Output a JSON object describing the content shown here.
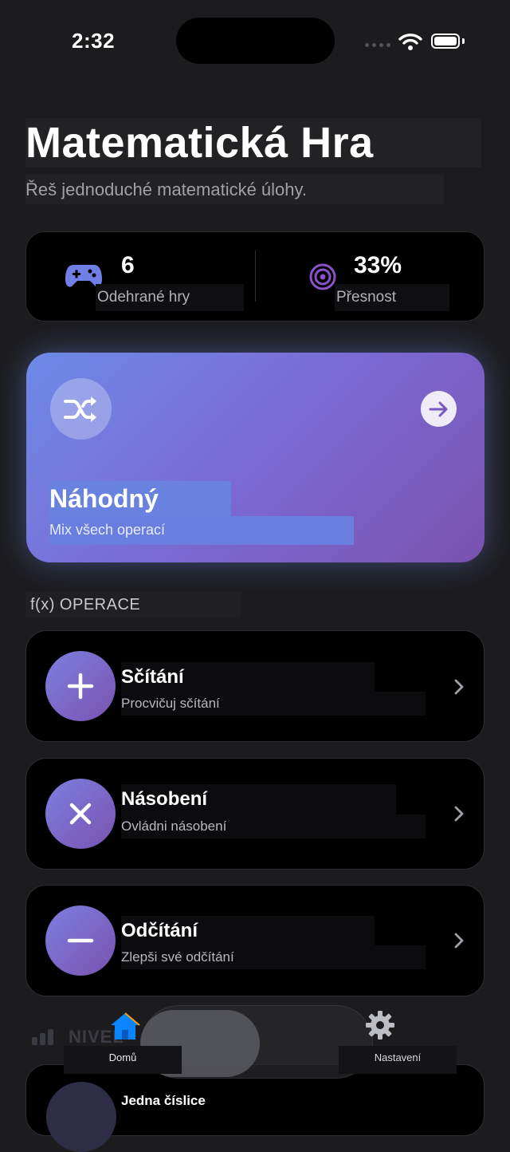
{
  "status_bar": {
    "time": "2:32"
  },
  "header": {
    "title": "Matematická Hra",
    "subtitle": "Řeš jednoduché matematické úlohy."
  },
  "stats": {
    "games": {
      "value": "6",
      "label": "Odehrané hry",
      "icon": "gamepad-icon"
    },
    "accuracy": {
      "value": "33%",
      "label": "Přesnost",
      "icon": "target-icon"
    }
  },
  "random_card": {
    "title": "Náhodný",
    "subtitle": "Mix všech operací",
    "icon": "shuffle-icon"
  },
  "operations_section": {
    "label": "f(x) OPERACE"
  },
  "operations": [
    {
      "title": "Sčítání",
      "subtitle": "Procvičuj sčítání",
      "icon": "plus-icon"
    },
    {
      "title": "Násobení",
      "subtitle": "Ovládni násobení",
      "icon": "multiply-icon"
    },
    {
      "title": "Odčítání",
      "subtitle": "Zlepši své odčítání",
      "icon": "minus-icon"
    }
  ],
  "level_section": {
    "label": "NIVEL",
    "first_item": "Jedna číslice"
  },
  "tabbar": {
    "home_label": "Domů",
    "settings_label": "Nastavení"
  },
  "colors": {
    "background": "#1c1c1e",
    "card": "#000000",
    "accent_start": "#6d8ae8",
    "accent_end": "#7a52b0",
    "home_tab": "#0a84ff"
  }
}
